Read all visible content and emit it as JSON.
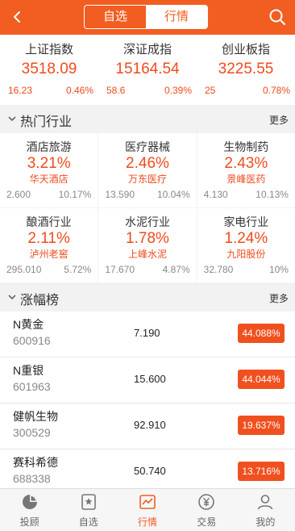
{
  "header": {
    "tabs": [
      "自选",
      "行情"
    ],
    "active_tab": "行情"
  },
  "indices": [
    {
      "name": "上证指数",
      "value": "3518.09",
      "change": "16.23",
      "percent": "0.46%"
    },
    {
      "name": "深证成指",
      "value": "15164.54",
      "change": "58.6",
      "percent": "0.39%"
    },
    {
      "name": "创业板指",
      "value": "3225.55",
      "change": "25",
      "percent": "0.78%"
    }
  ],
  "hot": {
    "title": "热门行业",
    "more": "更多",
    "rows": [
      [
        {
          "name": "酒店旅游",
          "percent": "3.21%",
          "stock": "华天酒店",
          "price": "2.600",
          "stock_pct": "10.17%"
        },
        {
          "name": "医疗器械",
          "percent": "2.46%",
          "stock": "万东医疗",
          "price": "13.590",
          "stock_pct": "10.04%"
        },
        {
          "name": "生物制药",
          "percent": "2.43%",
          "stock": "景峰医药",
          "price": "4.130",
          "stock_pct": "10.13%"
        }
      ],
      [
        {
          "name": "酿酒行业",
          "percent": "2.11%",
          "stock": "泸州老窖",
          "price": "295.010",
          "stock_pct": "5.72%"
        },
        {
          "name": "水泥行业",
          "percent": "1.78%",
          "stock": "上峰水泥",
          "price": "17.670",
          "stock_pct": "4.87%"
        },
        {
          "name": "家电行业",
          "percent": "1.24%",
          "stock": "九阳股份",
          "price": "32.780",
          "stock_pct": "10%"
        }
      ]
    ]
  },
  "gainers": {
    "title": "涨幅榜",
    "more": "更多",
    "items": [
      {
        "name": "N黄金",
        "code": "600916",
        "price": "7.190",
        "percent": "44.088%"
      },
      {
        "name": "N重银",
        "code": "601963",
        "price": "15.600",
        "percent": "44.044%"
      },
      {
        "name": "健帆生物",
        "code": "300529",
        "price": "92.910",
        "percent": "19.637%"
      },
      {
        "name": "赛科希德",
        "code": "688338",
        "price": "50.740",
        "percent": "13.716%"
      }
    ]
  },
  "tabbar": [
    {
      "label": "投顾",
      "icon": "pie-chart-icon"
    },
    {
      "label": "自选",
      "icon": "star-icon"
    },
    {
      "label": "行情",
      "icon": "trend-line-icon"
    },
    {
      "label": "交易",
      "icon": "yen-coin-icon"
    },
    {
      "label": "我的",
      "icon": "user-icon"
    }
  ],
  "colors": {
    "brand": "#f25d22",
    "up": "#ef4b1d"
  }
}
